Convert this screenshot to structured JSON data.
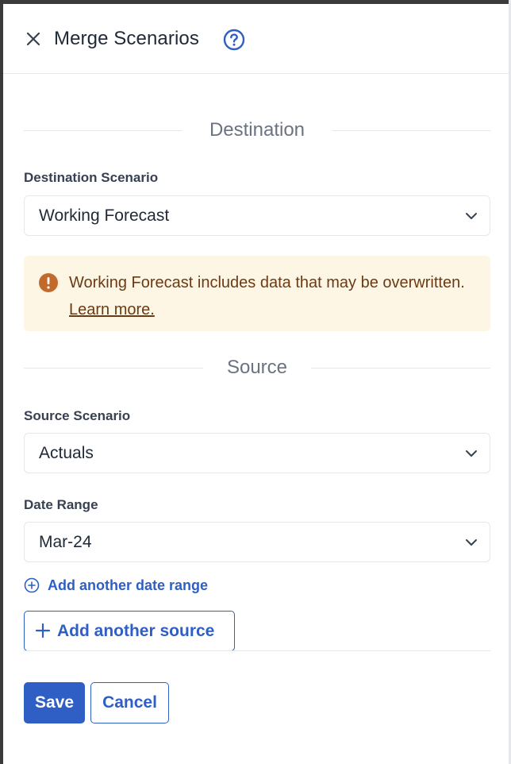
{
  "header": {
    "title": "Merge Scenarios"
  },
  "destination": {
    "section_label": "Destination",
    "field_label": "Destination Scenario",
    "selected": "Working Forecast"
  },
  "alert": {
    "message": "Working Forecast includes data that may be overwritten.",
    "link_text": "Learn more."
  },
  "source": {
    "section_label": "Source",
    "scenario_label": "Source Scenario",
    "scenario_selected": "Actuals",
    "date_range_label": "Date Range",
    "date_range_selected": "Mar-24",
    "add_date_range_label": "Add another date range",
    "add_source_label": "Add another source"
  },
  "footer": {
    "save_label": "Save",
    "cancel_label": "Cancel"
  },
  "colors": {
    "primary": "#2f5fc4",
    "alert_bg": "#fef6e4",
    "alert_icon": "#c26a2b",
    "alert_text": "#6b3a14"
  }
}
